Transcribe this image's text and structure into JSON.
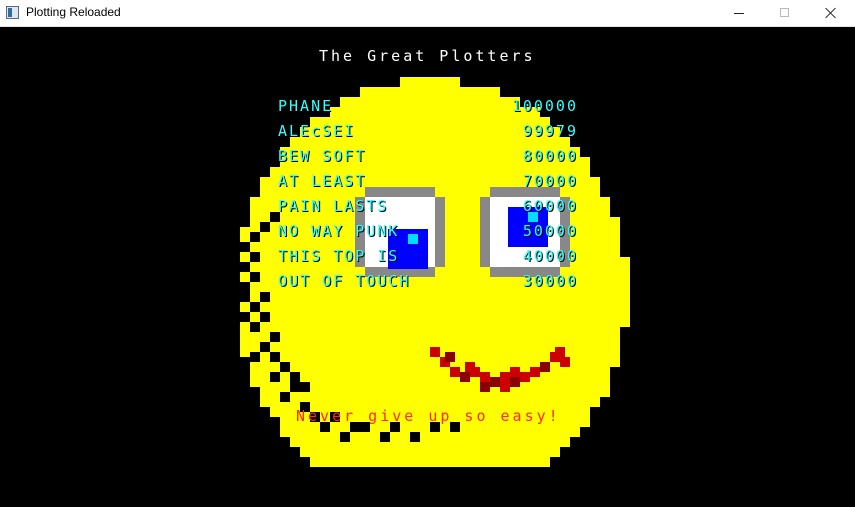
{
  "window": {
    "title": "Plotting Reloaded"
  },
  "screen_title": "The Great Plotters",
  "highscores": [
    {
      "name": "PHANE",
      "score": "100000"
    },
    {
      "name": "ALEcSEI",
      "score": "99979"
    },
    {
      "name": "BEW SOFT",
      "score": "80000"
    },
    {
      "name": "AT LEAST",
      "score": "70000"
    },
    {
      "name": "PAIN LASTS",
      "score": "60000"
    },
    {
      "name": "NO WAY PUNK",
      "score": "50000"
    },
    {
      "name": "THIS TOP IS",
      "score": "40000"
    },
    {
      "name": "OUT OF TOUCH",
      "score": "30000"
    }
  ],
  "message": "Never give up so easy!",
  "colors": {
    "background": "#000000",
    "face": "#ffff00",
    "eye_white": "#ffffff",
    "eye_border": "#888888",
    "pupil": "#0000ff",
    "pupil_highlight": "#00ddff",
    "mouth": "#cc0000",
    "mouth_dark": "#880000",
    "text_title": "#ffffff",
    "text_scores": "#33ffff",
    "text_message": "#ff2a1a"
  }
}
